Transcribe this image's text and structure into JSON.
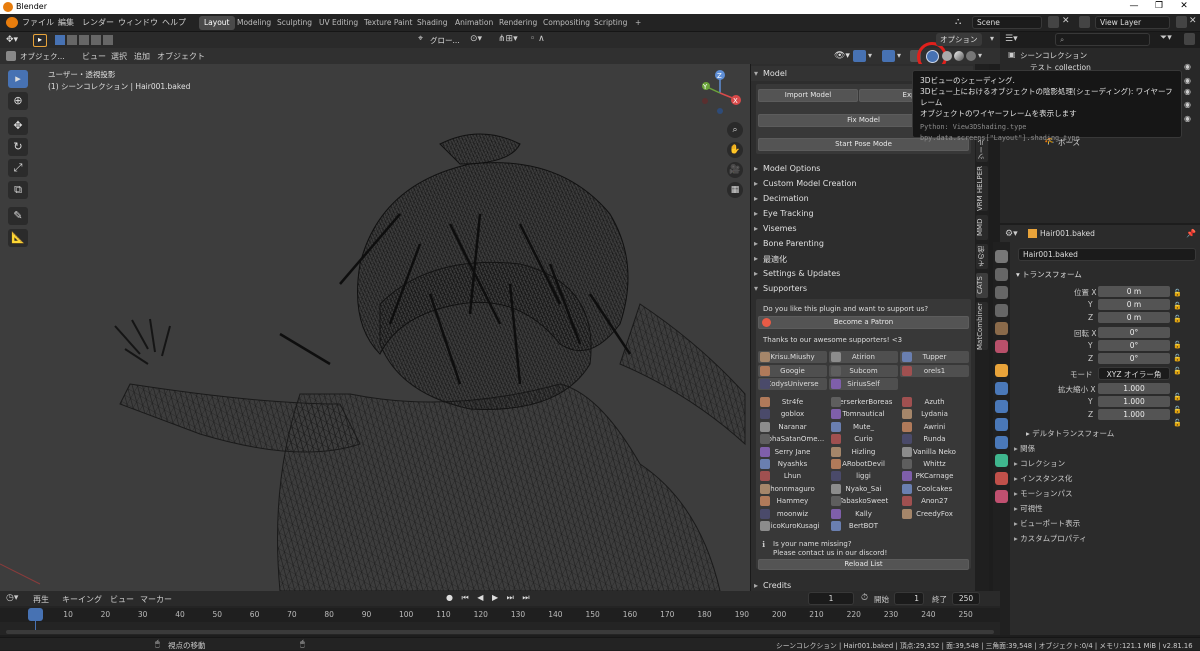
{
  "window": {
    "title": "Blender",
    "controls": [
      "—",
      "❐",
      "✕"
    ]
  },
  "menus": [
    "ファイル",
    "編集",
    "レンダー",
    "ウィンドウ",
    "ヘルプ"
  ],
  "workspaces": [
    "Layout",
    "Modeling",
    "Sculpting",
    "UV Editing",
    "Texture Paint",
    "Shading",
    "Animation",
    "Rendering",
    "Compositing",
    "Scripting",
    "+"
  ],
  "scene": {
    "name": "Scene",
    "view_layer": "View Layer"
  },
  "viewport_header": {
    "transform": "グロー...",
    "options": "オプション"
  },
  "viewport_menu": {
    "mode": "オブジェク...",
    "items": [
      "ビュー",
      "選択",
      "追加",
      "オブジェクト"
    ]
  },
  "viewport": {
    "view_name": "ユーザー・透視投影",
    "collection_info": "(1) シーンコレクション | Hair001.baked"
  },
  "gizmo": {
    "x": "X",
    "y": "Y",
    "z": "Z"
  },
  "tooltip": {
    "line1": "3Dビューのシェーディング.",
    "line2": "3Dビュー上におけるオブジェクトの陰影処理(シェーディング): ワイヤーフレーム",
    "line3": "オブジェクトのワイヤーフレームを表示します",
    "py1": "Python: View3DShading.type",
    "py2": "bpy.data.screens[\"Layout\"].shading.type"
  },
  "npanel": {
    "model_header": "Model",
    "import": "Import Model",
    "export": "Export",
    "fix": "Fix Model",
    "pose": "Start Pose Mode",
    "sections": [
      "Model Options",
      "Custom Model Creation",
      "Decimation",
      "Eye Tracking",
      "Visemes",
      "Bone Parenting",
      "最適化",
      "Settings & Updates"
    ],
    "supporters_header": "Supporters",
    "support_q": "Do you like this plugin and want to support us?",
    "patron": "Become a Patron",
    "thanks": "Thanks to our awesome supporters! <3",
    "top_supporters": [
      "Krisu.Miushy",
      "Atirion",
      "Tupper",
      "Googie",
      "Subcom",
      "orels1",
      "CodysUniverse",
      "SiriusSelf"
    ],
    "supporters": [
      "Str4fe",
      "BerserkerBoreas",
      "Azuth",
      "goblox",
      "Tomnautical",
      "Lydania",
      "Naranar",
      "Mute_",
      "Awrini",
      "AlphaSatanOme...",
      "Curio",
      "Runda",
      "Serry Jane",
      "Hizling",
      "Vanilla Neko",
      "Nyashks",
      "ARobotDevil",
      "Whittz",
      "Lhun",
      "liggi",
      "PKCarnage",
      "honnmaguro",
      "Nyako_Sai",
      "Coolcakes",
      "Hammey",
      "TabaskoSweet",
      "Anon27",
      "moonwiz",
      "Kally",
      "CreedyFox",
      "NicoKuroKusagi",
      "BertBOT"
    ],
    "missing1": "Is your name missing?",
    "missing2": "Please contact us in our discord!",
    "reload": "Reload List",
    "credits": "Credits"
  },
  "vtabs": [
    "ツール",
    "VRM HELPER",
    "MMD",
    "その他",
    "CATS",
    "MatCombiner"
  ],
  "outliner": {
    "title": "シーンコレクション",
    "collection": "テスト collection",
    "pose": "ポーズ"
  },
  "properties": {
    "object": "Hair001.baked",
    "object_field": "Hair001.baked",
    "transform": "トランスフォーム",
    "location_label": "位置 X",
    "rotation_label": "回転 X",
    "scale_label": "拡大縮小 X",
    "axis_y": "Y",
    "axis_z": "Z",
    "loc": [
      "0 m",
      "0 m",
      "0 m"
    ],
    "rot": [
      "0°",
      "0°",
      "0°"
    ],
    "mode_label": "モード",
    "mode": "XYZ オイラー角",
    "scale": [
      "1.000",
      "1.000",
      "1.000"
    ],
    "delta": "デルタトランスフォーム",
    "sections": [
      "関係",
      "コレクション",
      "インスタンス化",
      "モーションパス",
      "可視性",
      "ビューポート表示",
      "カスタムプロパティ"
    ]
  },
  "timeline": {
    "menus": [
      "再生",
      "キーイング",
      "ビュー",
      "マーカー"
    ],
    "current": "1",
    "start_label": "開始",
    "start": "1",
    "end_label": "終了",
    "end": "250",
    "ticks": [
      "1",
      "10",
      "20",
      "30",
      "40",
      "50",
      "60",
      "70",
      "80",
      "90",
      "100",
      "110",
      "120",
      "130",
      "140",
      "150",
      "160",
      "170",
      "180",
      "190",
      "200",
      "210",
      "220",
      "230",
      "240",
      "250"
    ]
  },
  "status": {
    "hint": "視点の移動",
    "info": "シーンコレクション | Hair001.baked | 頂点:29,352 | 面:39,548 | 三角面:39,548 | オブジェクト:0/4 | メモリ:121.1 MiB | v2.81.16"
  },
  "colors": {
    "accent": "#4772b3",
    "highlight_ring": "#e0201c",
    "patron_heart": "#e85b46"
  }
}
